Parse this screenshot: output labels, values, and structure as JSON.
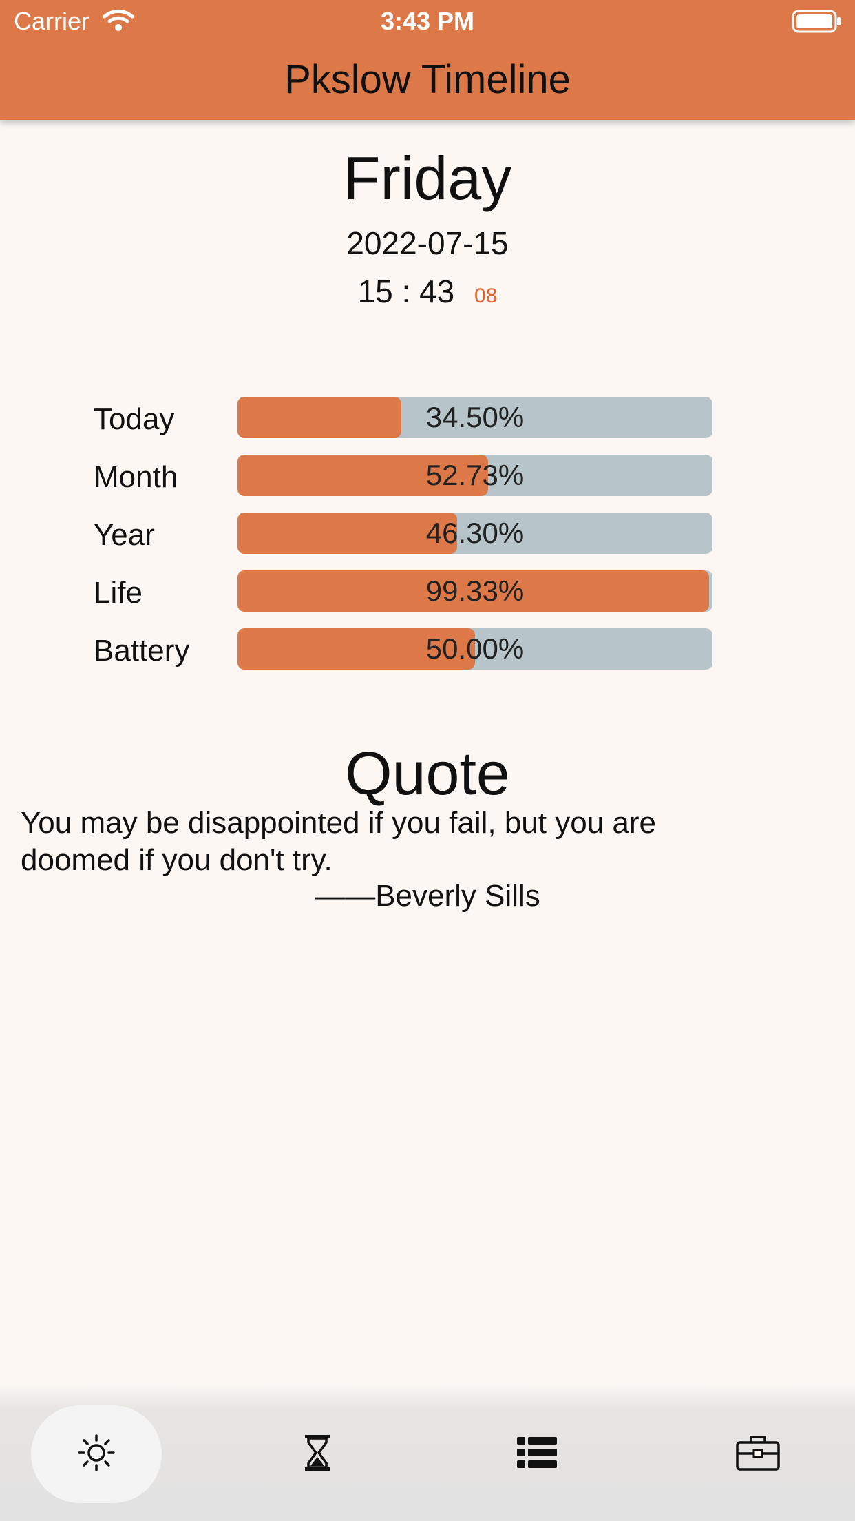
{
  "status_bar": {
    "carrier": "Carrier",
    "time": "3:43 PM"
  },
  "header": {
    "title": "Pkslow Timeline"
  },
  "datetime": {
    "day": "Friday",
    "date": "2022-07-15",
    "hour": "15",
    "separator": ":",
    "minute": "43",
    "second": "08"
  },
  "progress": [
    {
      "label": "Today",
      "value": 34.5,
      "text": "34.50%"
    },
    {
      "label": "Month",
      "value": 52.73,
      "text": "52.73%"
    },
    {
      "label": "Year",
      "value": 46.3,
      "text": "46.30%"
    },
    {
      "label": "Life",
      "value": 99.33,
      "text": "99.33%"
    },
    {
      "label": "Battery",
      "value": 50.0,
      "text": "50.00%"
    }
  ],
  "quote": {
    "title": "Quote",
    "text": "You may be disappointed if you fail, but you are doomed if you don't try.",
    "author": "——Beverly Sills"
  },
  "tabs": [
    {
      "icon": "sun-icon",
      "active": true
    },
    {
      "icon": "hourglass-icon",
      "active": false
    },
    {
      "icon": "list-icon",
      "active": false
    },
    {
      "icon": "briefcase-icon",
      "active": false
    }
  ],
  "colors": {
    "accent": "#dd7848",
    "track": "#b7c5ca",
    "seconds": "#e4602e",
    "background": "#fcf7f3"
  }
}
